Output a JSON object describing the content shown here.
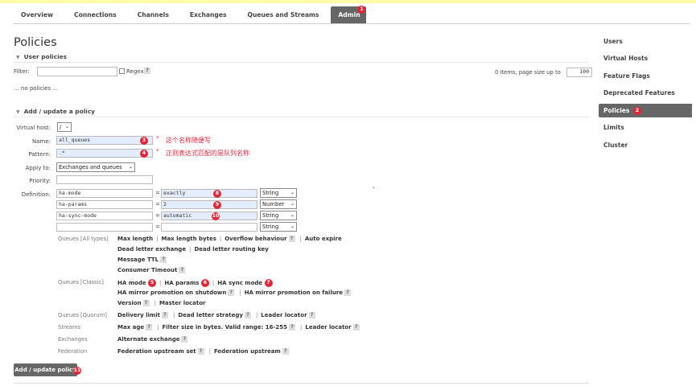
{
  "nav": {
    "tabs": [
      {
        "label": "Overview"
      },
      {
        "label": "Connections"
      },
      {
        "label": "Channels"
      },
      {
        "label": "Exchanges"
      },
      {
        "label": "Queues and Streams"
      },
      {
        "label": "Admin",
        "badge": "1"
      }
    ]
  },
  "page": {
    "title": "Policies"
  },
  "user_policies": {
    "heading": "User policies",
    "filter_label": "Filter:",
    "filter_value": "",
    "regex_label": "Regex",
    "help": "?",
    "page_size_text": "0 items, page size up to",
    "page_size_value": "100",
    "empty_text": "... no policies ..."
  },
  "form": {
    "heading": "Add / update a policy",
    "vhost_label": "Virtual host:",
    "vhost_value": "/",
    "name_label": "Name:",
    "name_value": "all_queues",
    "name_badge": "3",
    "name_note": "这个名称随便写",
    "pattern_label": "Pattern:",
    "pattern_value": ".*",
    "pattern_badge": "4",
    "pattern_note": "正则表达式匹配的是队列名称",
    "star": "*",
    "apply_label": "Apply to:",
    "apply_value": "Exchanges and queues",
    "priority_label": "Priority:",
    "priority_value": "",
    "definition_label": "Definition:",
    "eq": "=",
    "definition_rows": [
      {
        "key": "ha-mode",
        "value": "exactly",
        "type": "String",
        "badge": "8"
      },
      {
        "key": "ha-params",
        "value": "2",
        "type": "Number",
        "badge": "9"
      },
      {
        "key": "ha-sync-mode",
        "value": "automatic",
        "type": "String",
        "badge": "10"
      },
      {
        "key": "",
        "value": "",
        "type": "String",
        "badge": ""
      }
    ],
    "groups": {
      "all": {
        "label": "Queues [All types]",
        "line1": [
          "Max length",
          "Max length bytes",
          "Overflow behaviour",
          "Auto expire"
        ],
        "line2": [
          "Dead letter exchange",
          "Dead letter routing key"
        ],
        "line3": [
          "Message TTL"
        ],
        "line4": [
          "Consumer Timeout"
        ]
      },
      "classic": {
        "label": "Queues [Classic]",
        "line1": [
          "HA mode",
          "HA params",
          "HA sync mode"
        ],
        "badges": [
          "5",
          "6",
          "7"
        ],
        "line2": [
          "HA mirror promotion on shutdown",
          "HA mirror promotion on failure"
        ],
        "line3": [
          "Version",
          "Master locator"
        ]
      },
      "quorum": {
        "label": "Queues [Quorum]",
        "line1": [
          "Delivery limit",
          "Dead letter strategy",
          "Leader locator"
        ]
      },
      "streams": {
        "label": "Streams",
        "line1": [
          "Max age",
          "Filter size in bytes. Valid range: 16-255",
          "Leader locator"
        ]
      },
      "exchanges": {
        "label": "Exchanges",
        "line1": [
          "Alternate exchange"
        ]
      },
      "federation": {
        "label": "Federation",
        "line1": [
          "Federation upstream set",
          "Federation upstream"
        ]
      }
    },
    "submit_label": "Add / update policy",
    "submit_badge": "11"
  },
  "sidebar": {
    "items": [
      {
        "label": "Users"
      },
      {
        "label": "Virtual Hosts"
      },
      {
        "label": "Feature Flags"
      },
      {
        "label": "Deprecated Features"
      },
      {
        "label": "Policies",
        "badge": "2"
      },
      {
        "label": "Limits"
      },
      {
        "label": "Cluster"
      }
    ]
  },
  "colors": {
    "accent": "#666666",
    "badge": "#e2263a",
    "highlight": "#e3edfb",
    "top_stripe": "#ffffa8"
  }
}
